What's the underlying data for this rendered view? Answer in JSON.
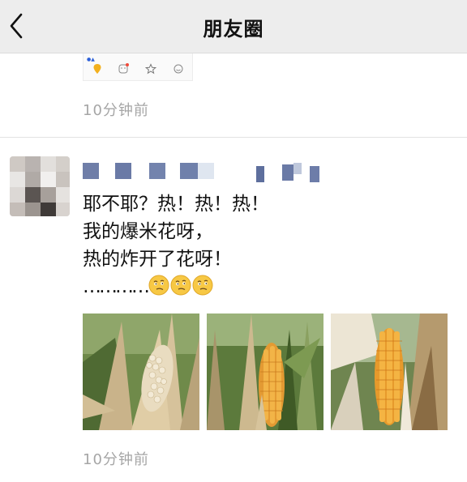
{
  "nav": {
    "title": "朋友圈",
    "back_icon": "chevron-left-icon"
  },
  "previous_post": {
    "time": "10分钟前",
    "shared_app_icons": [
      "location-pin-icon",
      "face-icon",
      "star-icon",
      "smile-icon"
    ]
  },
  "post": {
    "avatar": "pixelated-avatar",
    "nickname": "",
    "lines": [
      "耶不耶？热！热！热！",
      "我的爆米花呀，",
      "热的炸开了花呀！",
      "…………"
    ],
    "emojis": [
      "thinking-emoji",
      "thinking-emoji",
      "thinking-emoji"
    ],
    "photos": [
      {
        "name": "popped-corn-photo"
      },
      {
        "name": "corn-cob-photo-2"
      },
      {
        "name": "corn-cob-photo-3"
      }
    ],
    "time": "10分钟前"
  },
  "colors": {
    "navbar_bg": "#ededed",
    "time_gray": "#a6a6a6",
    "corn_yellow": "#e8a53a"
  }
}
